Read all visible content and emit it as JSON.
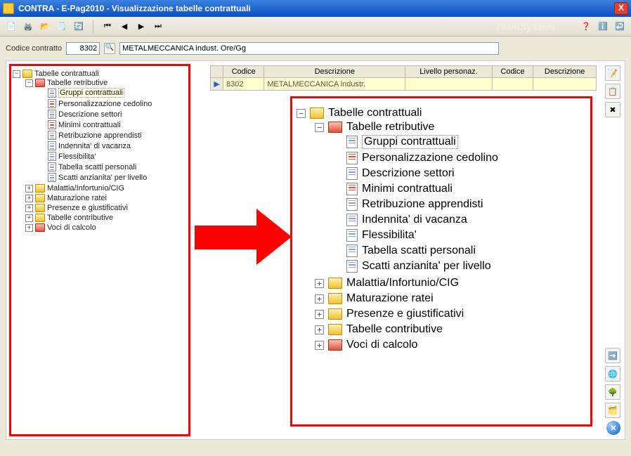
{
  "window": {
    "title": "CONTRA  -  E-Pag2010  -  Visualizzazione tabelle contrattuali",
    "close_x": "X"
  },
  "brand": "TeamSystem",
  "contract_bar": {
    "label": "Codice contratto",
    "code_value": "8302",
    "desc_value": "METALMECCANICA indust. Ore/Gg"
  },
  "grid": {
    "headers": [
      "Codice",
      "Descrizione",
      "Livello personaz.",
      "Codice",
      "Descrizione"
    ],
    "row_indicator": "▶",
    "row": {
      "codice": "8302",
      "descrizione": "METALMECCANICA industr.",
      "livello": "",
      "codice2": "",
      "descrizione2": ""
    }
  },
  "tree": {
    "root": {
      "label": "Tabelle contrattuali",
      "expanded": true
    },
    "retributive": {
      "label": "Tabelle retributive",
      "expanded": true
    },
    "retributive_items": [
      {
        "label": "Gruppi contrattuali",
        "icon": "doc",
        "selected": true
      },
      {
        "label": "Personalizzazione cedolino",
        "icon": "doc red"
      },
      {
        "label": "Descrizione settori",
        "icon": "doc"
      },
      {
        "label": "Minimi contrattuali",
        "icon": "doc red"
      },
      {
        "label": "Retribuzione apprendisti",
        "icon": "doc"
      },
      {
        "label": "Indennita' di vacanza",
        "icon": "doc"
      },
      {
        "label": "Flessibilita'",
        "icon": "doc"
      },
      {
        "label": "Tabella scatti personali",
        "icon": "doc"
      },
      {
        "label": "Scatti anzianita' per livello",
        "icon": "doc"
      }
    ],
    "folders": [
      {
        "label": "Malattia/Infortunio/CIG",
        "icon": "folder"
      },
      {
        "label": "Maturazione ratei",
        "icon": "folder"
      },
      {
        "label": "Presenze e giustificativi",
        "icon": "folder"
      },
      {
        "label": "Tabelle contributive",
        "icon": "folder"
      },
      {
        "label": "Voci di calcolo",
        "icon": "folder-red"
      }
    ]
  },
  "symbols": {
    "plus": "+",
    "minus": "−"
  }
}
